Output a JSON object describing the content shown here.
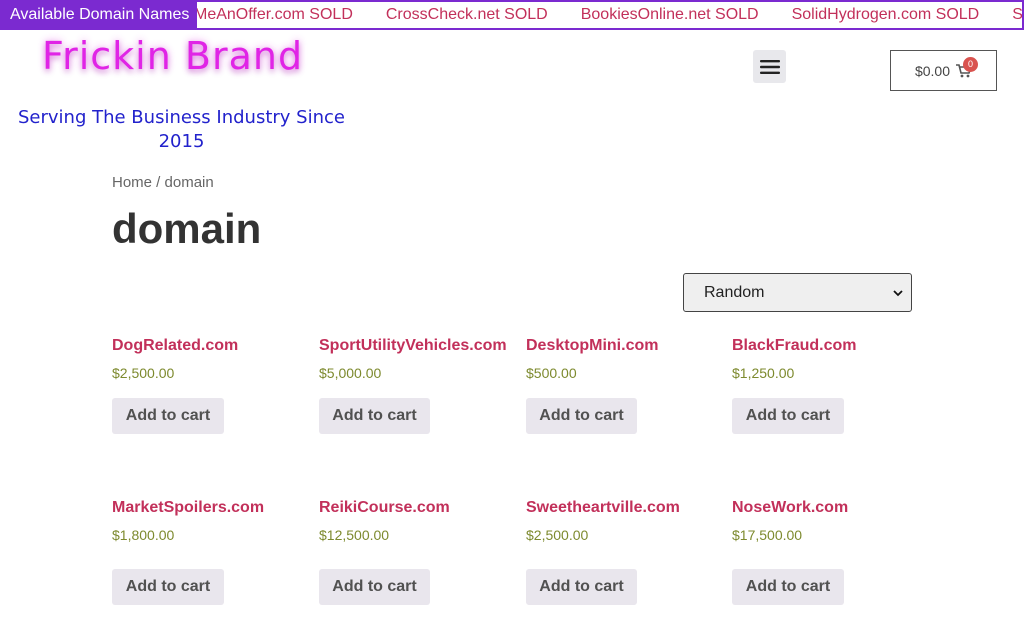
{
  "ticker": {
    "label": "Available Domain Names",
    "items": [
      "MeAnOffer.com SOLD",
      "CrossCheck.net SOLD",
      "BookiesOnline.net SOLD",
      "SolidHydrogen.com SOLD",
      "Sm"
    ]
  },
  "header": {
    "brand": "Frickin Brand",
    "tagline": "Serving The Business Industry Since 2015",
    "cart_amount": "$0.00",
    "cart_count": "0",
    "menu_icon": "hamburger-icon",
    "cart_icon": "cart-icon"
  },
  "breadcrumb": {
    "home": "Home",
    "separator": " / ",
    "current": "domain"
  },
  "page_title": "domain",
  "sort": {
    "selected": "Random"
  },
  "products": [
    {
      "name": "DogRelated.com",
      "price": "$2,500.00",
      "button": "Add to cart"
    },
    {
      "name": "SportUtilityVehicles.com",
      "price": "$5,000.00",
      "button": "Add to cart"
    },
    {
      "name": "DesktopMini.com",
      "price": "$500.00",
      "button": "Add to cart"
    },
    {
      "name": "BlackFraud.com",
      "price": "$1,250.00",
      "button": "Add to cart"
    },
    {
      "name": "MarketSpoilers.com",
      "price": "$1,800.00",
      "button": "Add to cart"
    },
    {
      "name": "ReikiCourse.com",
      "price": "$12,500.00",
      "button": "Add to cart"
    },
    {
      "name": "Sweetheartville.com",
      "price": "$2,500.00",
      "button": "Add to cart"
    },
    {
      "name": "NoseWork.com",
      "price": "$17,500.00",
      "button": "Add to cart"
    }
  ],
  "colors": {
    "accent_purple": "#7b2ad0",
    "link_pink": "#c2305a",
    "brand_magenta": "#e024e6",
    "tagline_blue": "#2222cc",
    "price_olive": "#7d8a2e",
    "badge_red": "#d9534f"
  }
}
